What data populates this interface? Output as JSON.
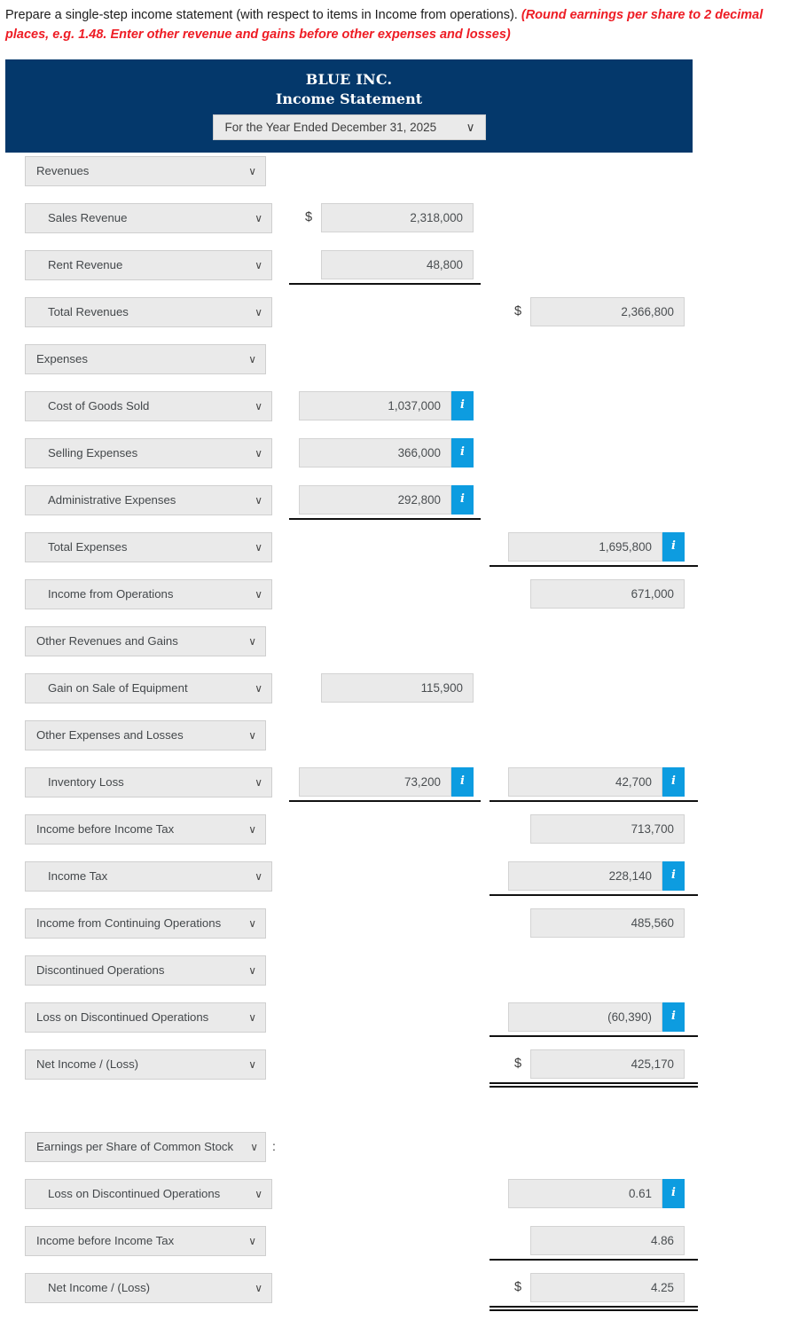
{
  "instructions": {
    "main": "Prepare a single-step income statement (with respect to items in Income from operations). ",
    "emphasis": "(Round earnings per share to 2 decimal places, e.g. 1.48. Enter other revenue and gains before other expenses and losses)"
  },
  "colors": {
    "banner_navy": "#04386b",
    "info_badge_blue": "#0d9ce0",
    "instruction_red": "#ee1c24",
    "field_grey": "#eaeaea"
  },
  "banner": {
    "company_name": "BLUE INC.",
    "statement_title": "Income Statement",
    "period_selected": "For the Year Ended December 31, 2025",
    "chevron": "∨"
  },
  "icons": {
    "chevron_down": "∨",
    "info": "i",
    "dollar": "$",
    "colon": ":"
  },
  "rows": [
    {
      "id": "revenues",
      "label": "Revenues",
      "level": 0
    },
    {
      "id": "sales-revenue",
      "label": "Sales Revenue",
      "level": 1,
      "col1": "2,318,000",
      "col1_dollar": true
    },
    {
      "id": "rent-revenue",
      "label": "Rent Revenue",
      "level": 1,
      "col1": "48,800",
      "rule_col1": "single"
    },
    {
      "id": "total-revenues",
      "label": "Total Revenues",
      "level": 1,
      "col2": "2,366,800",
      "col2_dollar": true
    },
    {
      "id": "expenses",
      "label": "Expenses",
      "level": 0
    },
    {
      "id": "cost-of-goods-sold",
      "label": "Cost of Goods Sold",
      "level": 1,
      "col1": "1,037,000",
      "col1_info": true
    },
    {
      "id": "selling-expenses",
      "label": "Selling Expenses",
      "level": 1,
      "col1": "366,000",
      "col1_info": true
    },
    {
      "id": "admin-expenses",
      "label": "Administrative Expenses",
      "level": 1,
      "col1": "292,800",
      "col1_info": true,
      "rule_col1": "single"
    },
    {
      "id": "total-expenses",
      "label": "Total Expenses",
      "level": 1,
      "col2": "1,695,800",
      "col2_info": true,
      "rule_col2": "single"
    },
    {
      "id": "income-from-operations",
      "label": "Income from Operations",
      "level": 1,
      "col2": "671,000"
    },
    {
      "id": "other-revenues-gains",
      "label": "Other Revenues and Gains",
      "level": 0
    },
    {
      "id": "gain-on-sale-equipment",
      "label": "Gain on Sale of Equipment",
      "level": 1,
      "col1": "115,900"
    },
    {
      "id": "other-expenses-losses",
      "label": "Other Expenses and Losses",
      "level": 0
    },
    {
      "id": "inventory-loss",
      "label": "Inventory Loss",
      "level": 1,
      "col1": "73,200",
      "col1_info": true,
      "col2": "42,700",
      "col2_info": true,
      "rule_col1": "single",
      "rule_col2": "single"
    },
    {
      "id": "income-before-tax",
      "label": "Income before Income Tax",
      "level": 0,
      "col2": "713,700"
    },
    {
      "id": "income-tax",
      "label": "Income Tax",
      "level": 1,
      "col2": "228,140",
      "col2_info": true,
      "rule_col2": "single"
    },
    {
      "id": "income-continuing-ops",
      "label": "Income from Continuing Operations",
      "level": 0,
      "col2": "485,560"
    },
    {
      "id": "discontinued-operations",
      "label": "Discontinued Operations",
      "level": 0
    },
    {
      "id": "loss-discontinued-ops",
      "label": "Loss on Discontinued Operations",
      "level": 0,
      "col2": "(60,390)",
      "col2_info": true,
      "rule_col2": "single"
    },
    {
      "id": "net-income-loss",
      "label": "Net Income / (Loss)",
      "level": 0,
      "col2": "425,170",
      "col2_dollar": true,
      "rule_col2": "double"
    },
    {
      "id": "spacer",
      "label": "",
      "spacer": true
    },
    {
      "id": "eps-common-stock",
      "label": "Earnings per Share of Common Stock",
      "level": 0,
      "wide": true,
      "colon": true
    },
    {
      "id": "eps-loss-discontinued",
      "label": "Loss on Discontinued Operations",
      "level": 1,
      "col2": "0.61",
      "col2_info": true,
      "col2_dollar": true
    },
    {
      "id": "eps-income-before-tax",
      "label": "Income before Income Tax",
      "level": 0,
      "col2": "4.86",
      "rule_col2": "single"
    },
    {
      "id": "eps-net-income",
      "label": "Net Income / (Loss)",
      "level": 1,
      "col2": "4.25",
      "col2_dollar": true,
      "rule_col2": "double"
    }
  ]
}
